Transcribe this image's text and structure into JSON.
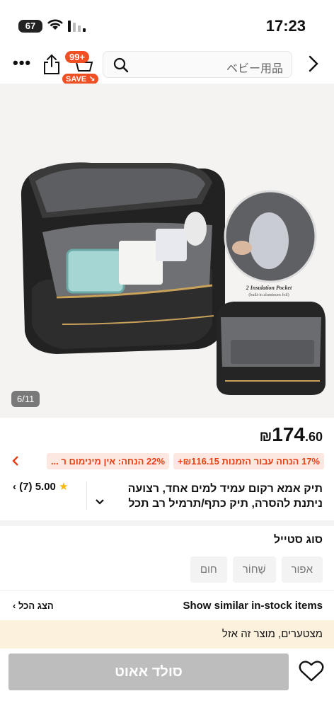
{
  "status_bar": {
    "battery": "67",
    "time": "17:23"
  },
  "nav": {
    "cart_count": "99+",
    "cart_badge": "SAVE",
    "search_placeholder": "ベビー用品"
  },
  "gallery": {
    "counter": "6/11",
    "insert_caption": "2 Insulation Pocket",
    "insert_subcaption": "(built-in aluminum foil)"
  },
  "product": {
    "currency": "₪",
    "price_int": "174",
    "price_dec": ".60",
    "promos": [
      "17% הנחה עבור הזמנות ₪116.15+",
      "22% הנחה: אין מינימום ר ..."
    ],
    "rating": "5.00",
    "review_count": "(7)",
    "title": "תיק אמא רקום עמיד למים אחד, רצועה ניתנת להסרה, תיק כתף/תרמיל רב תכל"
  },
  "style": {
    "label": "סוג סטייל",
    "options": [
      "אפור",
      "שָׁחוֹר",
      "חום"
    ]
  },
  "similar": {
    "title": "Show similar in-stock items",
    "view_all": "הצג הכל"
  },
  "notice": "מצטערים, מוצר זה אזל",
  "actions": {
    "sold_out": "סולד אאוט"
  },
  "colors": {
    "accent": "#f04e23",
    "promo_bg": "#fde8e1",
    "notice_bg": "#fcf1dc",
    "button_disabled": "#bdbdbd"
  }
}
